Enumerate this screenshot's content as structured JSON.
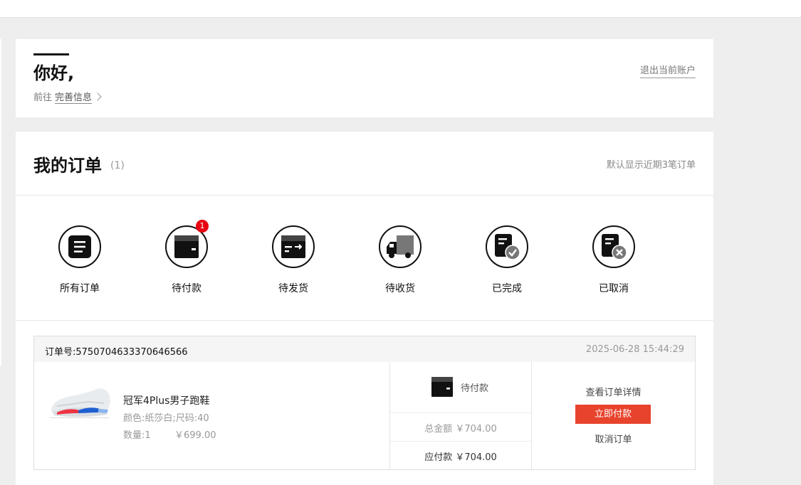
{
  "welcome": {
    "greeting": "你好,",
    "goto_prefix": "前往",
    "profile_link": "完善信息",
    "logout": "退出当前账户"
  },
  "orders": {
    "title": "我的订单",
    "count": "(1)",
    "note": "默认显示近期3笔订单",
    "statuses": [
      {
        "label": "所有订单",
        "icon": "all-orders-icon"
      },
      {
        "label": "待付款",
        "icon": "wallet-icon",
        "badge": "1"
      },
      {
        "label": "待发货",
        "icon": "to-ship-icon"
      },
      {
        "label": "待收货",
        "icon": "delivery-truck-icon"
      },
      {
        "label": "已完成",
        "icon": "completed-icon"
      },
      {
        "label": "已取消",
        "icon": "cancelled-icon"
      }
    ]
  },
  "order": {
    "number_label": "订单号:5750704633370646566",
    "time": "2025-06-28 15:44:29",
    "product": {
      "name": "冠军4Plus男子跑鞋",
      "attrs": "颜色:纸莎白;尺码:40",
      "qty": "数量:1",
      "price": "￥699.00"
    },
    "status_text": "待付款",
    "total": "总金额 ￥704.00",
    "payable": "应付款 ￥704.00",
    "actions": {
      "detail": "查看订单详情",
      "pay": "立即付款",
      "cancel": "取消订单"
    }
  },
  "colors": {
    "accent": "#e8432d",
    "badge": "#e60012",
    "background": "#eeeeee"
  }
}
